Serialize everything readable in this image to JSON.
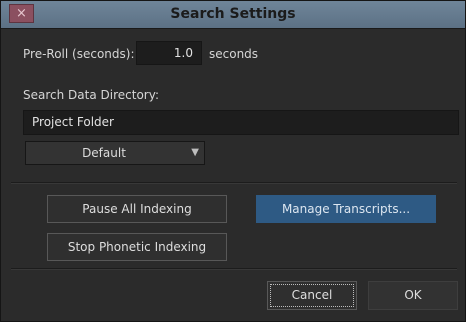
{
  "window": {
    "title": "Search Settings",
    "close_glyph": "×"
  },
  "preroll": {
    "label": "Pre-Roll (seconds):",
    "value": "1.0",
    "unit": "seconds"
  },
  "search_dir": {
    "label": "Search Data Directory:",
    "value": "Project Folder",
    "select_value": "Default",
    "select_arrow": "▼"
  },
  "indexing": {
    "pause_label": "Pause All Indexing",
    "stop_label": "Stop Phonetic Indexing",
    "manage_label": "Manage Transcripts..."
  },
  "footer": {
    "cancel_label": "Cancel",
    "ok_label": "OK"
  },
  "colors": {
    "titlebar": "#6f8599",
    "background": "#2b2b2b",
    "primary_button": "#2e5a84",
    "close_button": "#8b5060"
  }
}
